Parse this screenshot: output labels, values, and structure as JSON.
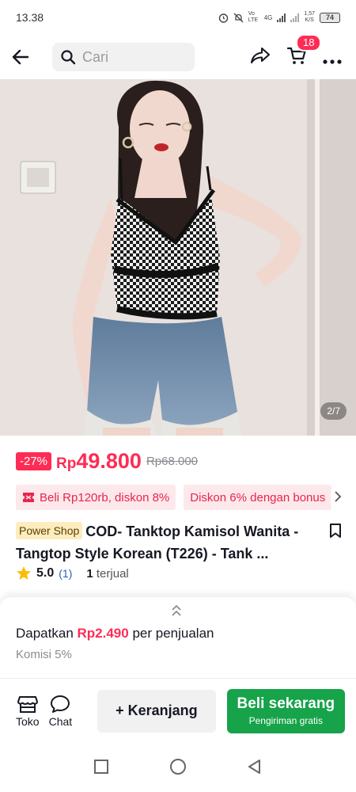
{
  "status_bar": {
    "time": "13.38",
    "net_speed_value": "1,57",
    "net_speed_unit": "K/S",
    "battery": "74",
    "volte": "Vo LTE",
    "network": "4G"
  },
  "header": {
    "search_placeholder": "Cari",
    "cart_count": "18"
  },
  "product": {
    "image_counter": "2/7",
    "discount": "-27%",
    "currency": "Rp",
    "price": "49.800",
    "original_price": "Rp68.000",
    "vouchers": [
      "Beli Rp120rb, diskon 8%",
      "Diskon 6% dengan bonus"
    ],
    "badge": "Power Shop",
    "title_line1": "COD- Tanktop Kamisol Wanita -",
    "title_line2": "Tangtop Style Korean (T226) - Tank ...",
    "rating": "5.0",
    "rating_count": "(1)",
    "sold_count": "1",
    "sold_label": "terjual"
  },
  "affiliate": {
    "text_prefix": "Dapatkan",
    "amount": "Rp2.490",
    "text_suffix": "per penjualan",
    "commission": "Komisi 5%"
  },
  "actions": {
    "shop_label": "Toko",
    "chat_label": "Chat",
    "cart_label": "+ Keranjang",
    "buy_label": "Beli sekarang",
    "buy_sub": "Pengiriman gratis"
  },
  "colors": {
    "accent": "#fe2c55",
    "buy": "#16a34a"
  }
}
